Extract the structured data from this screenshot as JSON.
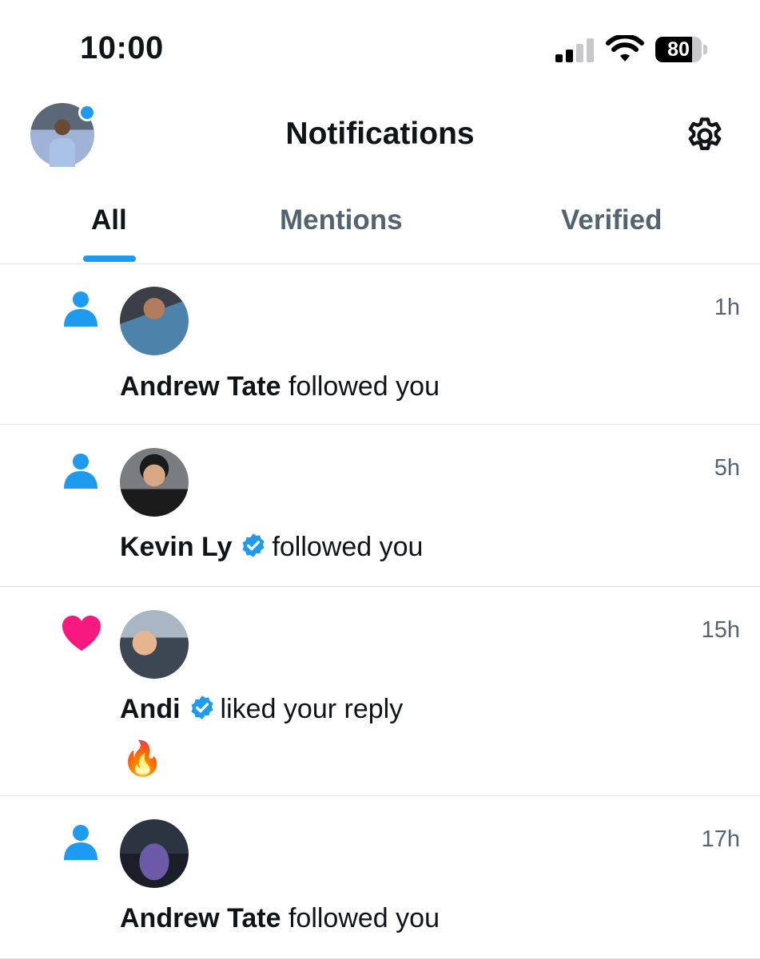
{
  "status_bar": {
    "time": "10:00",
    "battery": "80",
    "battery_level": 0.8
  },
  "header": {
    "title": "Notifications",
    "profile_has_unread": true
  },
  "tabs": [
    {
      "label": "All",
      "active": true
    },
    {
      "label": "Mentions",
      "active": false
    },
    {
      "label": "Verified",
      "active": false
    }
  ],
  "notifications": [
    {
      "type": "follow",
      "icon": "person-icon",
      "name": "Andrew Tate",
      "verified": false,
      "action": "followed you",
      "time": "1h"
    },
    {
      "type": "follow",
      "icon": "person-icon",
      "name": "Kevin Ly",
      "verified": true,
      "action": "followed you",
      "time": "5h"
    },
    {
      "type": "like",
      "icon": "heart-icon",
      "name": "Andi",
      "verified": true,
      "action": "liked your reply",
      "time": "15h",
      "content": "🔥"
    },
    {
      "type": "follow",
      "icon": "person-icon",
      "name": "Andrew Tate",
      "verified": false,
      "action": "followed you",
      "time": "17h"
    }
  ],
  "colors": {
    "accent": "#1d9bf0",
    "like": "#f91880",
    "secondary_text": "#536471",
    "divider": "#e1e5e9"
  }
}
